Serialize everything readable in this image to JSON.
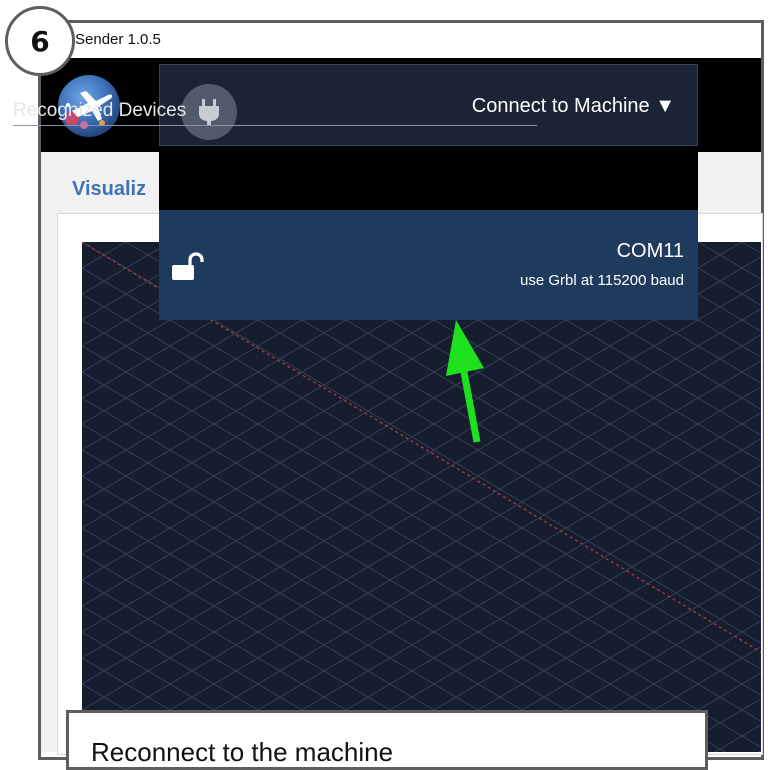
{
  "tutorial": {
    "step_number": "6",
    "caption": "Reconnect to the machine"
  },
  "window": {
    "title": "Sender 1.0.5"
  },
  "visualizer": {
    "title": "Visualiz"
  },
  "connect_dropdown": {
    "plug_icon": "plug-icon",
    "label": "Connect to Machine ▼",
    "section_label": "Recognized Devices",
    "devices": [
      {
        "name": "COM11",
        "description": "use Grbl at 115200 baud",
        "icon": "unlocked-padlock-icon"
      }
    ]
  },
  "colors": {
    "header_bg": "#000000",
    "dropdown_bg": "#1b2435",
    "device_row_bg": "#1e3a5c",
    "canvas_bg": "#161d2f",
    "accent_title": "#3f74b5",
    "arrow": "#1ee01e"
  }
}
